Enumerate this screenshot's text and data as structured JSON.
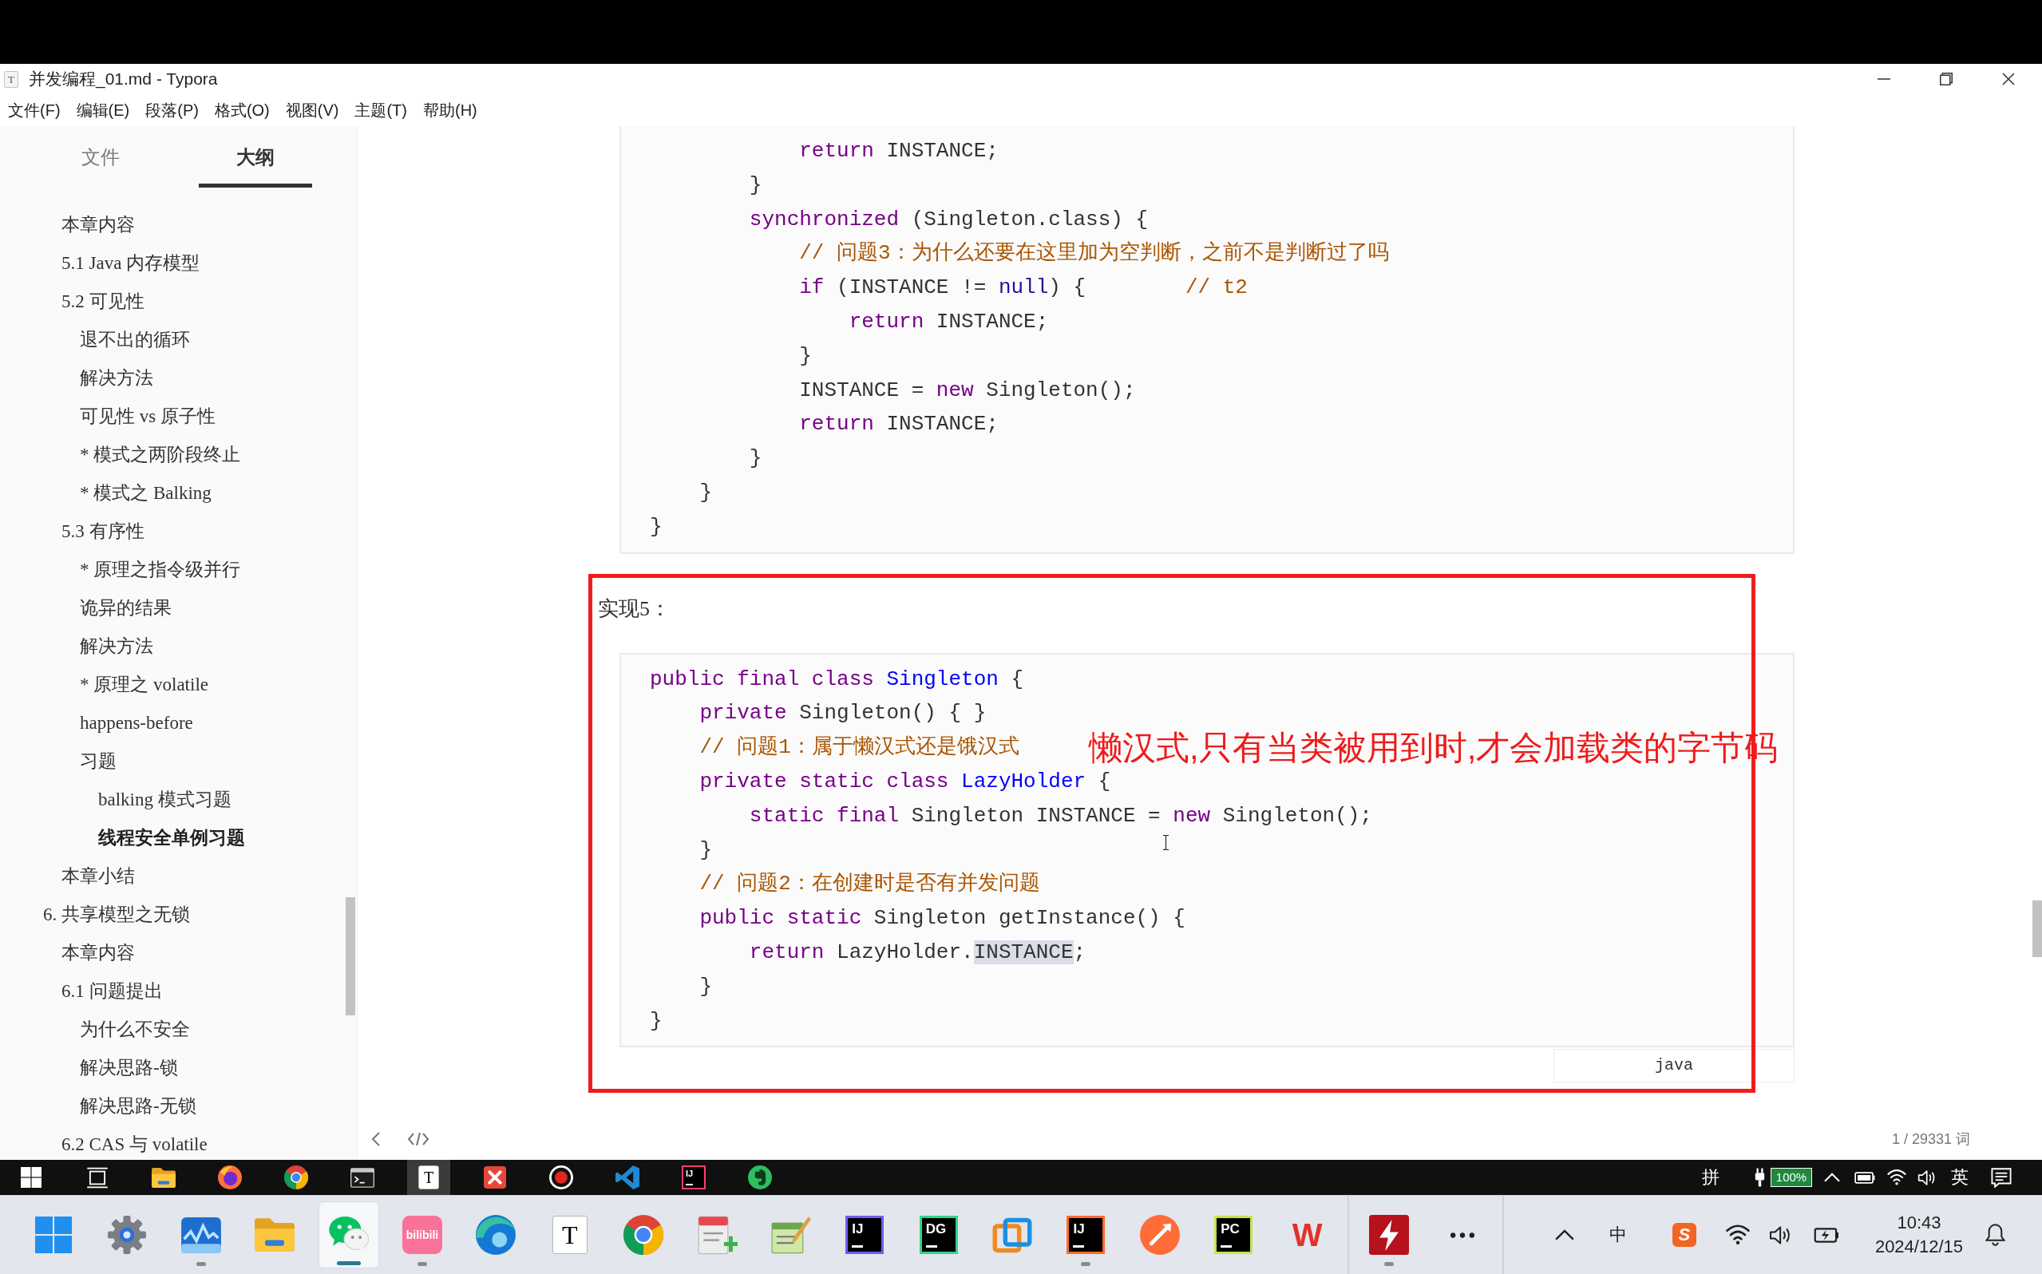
{
  "window": {
    "icon_letter": "T",
    "title": "并发编程_01.md - Typora"
  },
  "menu": [
    "文件(F)",
    "编辑(E)",
    "段落(P)",
    "格式(O)",
    "视图(V)",
    "主题(T)",
    "帮助(H)"
  ],
  "sidebar": {
    "tabs": [
      {
        "label": "文件",
        "selected": false
      },
      {
        "label": "大纲",
        "selected": true
      }
    ],
    "outline": [
      {
        "children": [
          {
            "label": "本章内容",
            "selected": false
          },
          {
            "label": "5.1 Java 内存模型",
            "selected": false
          },
          {
            "label": "5.2 可见性",
            "selected": false,
            "children": [
              {
                "label": "退不出的循环",
                "selected": false
              },
              {
                "label": "解决方法",
                "selected": false
              },
              {
                "label": "可见性 vs 原子性",
                "selected": false
              },
              {
                "label": "* 模式之两阶段终止",
                "selected": false
              },
              {
                "label": "* 模式之 Balking",
                "selected": false
              }
            ]
          },
          {
            "label": "5.3 有序性",
            "selected": false,
            "children": [
              {
                "label": "* 原理之指令级并行",
                "selected": false
              },
              {
                "label": "诡异的结果",
                "selected": false
              },
              {
                "label": "解决方法",
                "selected": false
              },
              {
                "label": "* 原理之 volatile",
                "selected": false
              },
              {
                "label": "happens-before",
                "selected": false
              },
              {
                "label": "习题",
                "selected": false,
                "children": [
                  {
                    "label": "balking 模式习题",
                    "selected": false
                  },
                  {
                    "label": "线程安全单例习题",
                    "selected": true
                  }
                ]
              }
            ]
          },
          {
            "label": "本章小结",
            "selected": false
          }
        ]
      },
      {
        "label": "6. 共享模型之无锁",
        "selected": false,
        "children": [
          {
            "label": "本章内容",
            "selected": false
          },
          {
            "label": "6.1 问题提出",
            "selected": false,
            "children": [
              {
                "label": "为什么不安全",
                "selected": false
              },
              {
                "label": "解决思路-锁",
                "selected": false
              },
              {
                "label": "解决思路-无锁",
                "selected": false
              }
            ]
          },
          {
            "label": "6.2 CAS 与 volatile",
            "selected": false
          }
        ]
      }
    ]
  },
  "editor": {
    "blocks": [
      {
        "kind": "code",
        "lines": [
          [
            {
              "text": "            return",
              "kind": "keyword"
            },
            {
              "text": " INSTANCE;",
              "kind": "plain"
            }
          ],
          [
            {
              "text": "        }",
              "kind": "plain"
            }
          ],
          [
            {
              "text": "        synchronized",
              "kind": "keyword"
            },
            {
              "text": " (Singleton.class) {",
              "kind": "plain"
            }
          ],
          [
            {
              "text": "            // 问题3：为什么还要在这里加为空判断，之前不是判断过了吗",
              "kind": "comment"
            }
          ],
          [
            {
              "text": "            if",
              "kind": "keyword"
            },
            {
              "text": " (INSTANCE != ",
              "kind": "plain"
            },
            {
              "text": "null",
              "kind": "atom"
            },
            {
              "text": ") {        ",
              "kind": "plain"
            },
            {
              "text": "// t2",
              "kind": "comment"
            }
          ],
          [
            {
              "text": "                return",
              "kind": "keyword"
            },
            {
              "text": " INSTANCE;",
              "kind": "plain"
            }
          ],
          [
            {
              "text": "            }",
              "kind": "plain"
            }
          ],
          [
            {
              "text": "            INSTANCE = ",
              "kind": "plain"
            },
            {
              "text": "new",
              "kind": "keyword"
            },
            {
              "text": " Singleton();",
              "kind": "plain"
            }
          ],
          [
            {
              "text": "            return",
              "kind": "keyword"
            },
            {
              "text": " INSTANCE;",
              "kind": "plain"
            }
          ],
          [
            {
              "text": "        }",
              "kind": "plain"
            }
          ],
          [
            {
              "text": "    }",
              "kind": "plain"
            }
          ],
          [
            {
              "text": "}",
              "kind": "plain"
            }
          ]
        ]
      },
      {
        "kind": "paragraph",
        "text": "实现5："
      },
      {
        "kind": "code",
        "language": "java",
        "lines": [
          [
            {
              "text": "public final class ",
              "kind": "keyword"
            },
            {
              "text": "Singleton",
              "kind": "def"
            },
            {
              "text": " {",
              "kind": "plain"
            }
          ],
          [
            {
              "text": "    private",
              "kind": "keyword"
            },
            {
              "text": " Singleton() { }",
              "kind": "plain"
            }
          ],
          [
            {
              "text": "    // 问题1：属于懒汉式还是饿汉式",
              "kind": "comment"
            }
          ],
          [
            {
              "text": "    private static class ",
              "kind": "keyword"
            },
            {
              "text": "LazyHolder",
              "kind": "def"
            },
            {
              "text": " {",
              "kind": "plain"
            }
          ],
          [
            {
              "text": "        static final",
              "kind": "keyword"
            },
            {
              "text": " Singleton INSTANCE = ",
              "kind": "plain"
            },
            {
              "text": "new",
              "kind": "keyword"
            },
            {
              "text": " Singleton();",
              "kind": "plain"
            }
          ],
          [
            {
              "text": "    }",
              "kind": "plain"
            }
          ],
          [
            {
              "text": "    // 问题2：在创建时是否有并发问题",
              "kind": "comment"
            }
          ],
          [
            {
              "text": "    public static",
              "kind": "keyword"
            },
            {
              "text": " Singleton getInstance() {",
              "kind": "plain"
            }
          ],
          [
            {
              "text": "        return",
              "kind": "keyword"
            },
            {
              "text": " LazyHolder.",
              "kind": "plain"
            },
            {
              "text": "INSTANCE",
              "kind": "match"
            },
            {
              "text": ";",
              "kind": "plain"
            }
          ],
          [
            {
              "text": "    }",
              "kind": "plain"
            }
          ],
          [
            {
              "text": "}",
              "kind": "plain"
            }
          ]
        ]
      }
    ],
    "annotation": {
      "text": "懒汉式,只有当类被用到时,才会加载类的字节码"
    }
  },
  "status_bar": {
    "word_count": "1 / 29331 词"
  },
  "upper_taskbar": {
    "apps": [
      {
        "kind": "start",
        "selected": false
      },
      {
        "kind": "taskview",
        "selected": false
      },
      {
        "kind": "folder",
        "selected": false
      },
      {
        "kind": "firefox",
        "selected": false
      },
      {
        "kind": "chrome",
        "selected": false
      },
      {
        "kind": "terminal",
        "selected": false
      },
      {
        "kind": "typora",
        "text": "T",
        "selected": true
      },
      {
        "kind": "xmind",
        "selected": false
      },
      {
        "kind": "recorder",
        "selected": false
      },
      {
        "kind": "vscode",
        "selected": false
      },
      {
        "kind": "intellij",
        "text": "IJ",
        "selected": false
      },
      {
        "kind": "evernote",
        "selected": false
      }
    ],
    "tray": [
      {
        "kind": "ime",
        "text": "拼"
      },
      {
        "kind": "plug"
      },
      {
        "kind": "percent",
        "text": "100%"
      },
      {
        "kind": "chevron"
      },
      {
        "kind": "battery"
      },
      {
        "kind": "wifi"
      },
      {
        "kind": "volume"
      },
      {
        "kind": "ime",
        "text": "英"
      },
      {
        "kind": "notifications"
      }
    ]
  },
  "lower_taskbar": {
    "groups": [
      {
        "apps": [
          {
            "kind": "start",
            "selected": false,
            "running": false
          },
          {
            "kind": "settings",
            "selected": false,
            "running": false
          },
          {
            "kind": "monitor",
            "selected": false,
            "running": true
          },
          {
            "kind": "folder",
            "selected": false,
            "running": false
          },
          {
            "kind": "wechat",
            "selected": true,
            "running": true
          },
          {
            "kind": "bilibili",
            "text": "bilibili",
            "selected": false,
            "running": true
          },
          {
            "kind": "edge",
            "selected": false,
            "running": false
          },
          {
            "kind": "typora",
            "text": "T",
            "selected": false,
            "running": false
          },
          {
            "kind": "chrome",
            "selected": false,
            "running": false
          },
          {
            "kind": "notepad",
            "selected": false,
            "running": false
          },
          {
            "kind": "sketchpad",
            "selected": false,
            "running": false
          },
          {
            "kind": "intellij",
            "text": "IJ",
            "selected": false,
            "running": false
          },
          {
            "kind": "datagrip",
            "text": "DG",
            "selected": false,
            "running": false
          },
          {
            "kind": "squares",
            "selected": false,
            "running": false
          },
          {
            "kind": "ultimate",
            "text": "IJ",
            "selected": false,
            "running": true
          },
          {
            "kind": "postman",
            "selected": false,
            "running": false
          },
          {
            "kind": "pycharm",
            "text": "PC",
            "selected": false,
            "running": false
          },
          {
            "kind": "wps",
            "text": "W",
            "selected": false,
            "running": false
          }
        ]
      },
      {
        "apps": [
          {
            "kind": "lightning",
            "selected": false,
            "running": true
          },
          {
            "kind": "more",
            "selected": false,
            "running": false
          }
        ]
      }
    ],
    "tray": [
      {
        "kind": "chevron"
      },
      {
        "kind": "ime",
        "text": "中"
      },
      {
        "kind": "logo",
        "text": "S"
      },
      {
        "kind": "wifi"
      },
      {
        "kind": "volume"
      },
      {
        "kind": "charging"
      },
      {
        "kind": "clock",
        "time": "10:43",
        "date": "2024/12/15"
      },
      {
        "kind": "bell"
      }
    ]
  }
}
